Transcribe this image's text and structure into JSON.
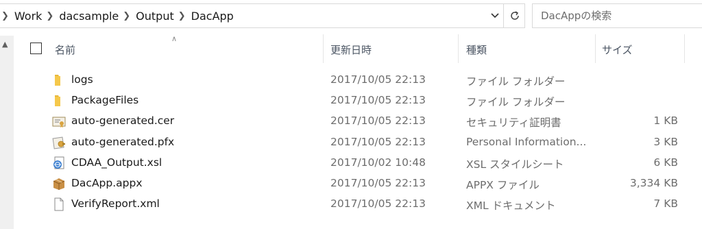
{
  "breadcrumb": [
    "Work",
    "dacsample",
    "Output",
    "DacApp"
  ],
  "search": {
    "placeholder": "DacAppの検索"
  },
  "columns": {
    "name": "名前",
    "date": "更新日時",
    "type": "種類",
    "size": "サイズ"
  },
  "files": [
    {
      "icon": "folder-icon",
      "name": "logs",
      "date": "2017/10/05 22:13",
      "type": "ファイル フォルダー",
      "size": ""
    },
    {
      "icon": "folder-icon",
      "name": "PackageFiles",
      "date": "2017/10/05 22:13",
      "type": "ファイル フォルダー",
      "size": ""
    },
    {
      "icon": "certificate-icon",
      "name": "auto-generated.cer",
      "date": "2017/10/05 22:13",
      "type": "セキュリティ証明書",
      "size": "1 KB"
    },
    {
      "icon": "pfx-icon",
      "name": "auto-generated.pfx",
      "date": "2017/10/05 22:13",
      "type": "Personal Information...",
      "size": "3 KB"
    },
    {
      "icon": "xsl-icon",
      "name": "CDAA_Output.xsl",
      "date": "2017/10/02 10:48",
      "type": "XSL スタイルシート",
      "size": "6 KB"
    },
    {
      "icon": "package-icon",
      "name": "DacApp.appx",
      "date": "2017/10/05 22:13",
      "type": "APPX ファイル",
      "size": "3,334 KB"
    },
    {
      "icon": "document-icon",
      "name": "VerifyReport.xml",
      "date": "2017/10/05 22:13",
      "type": "XML ドキュメント",
      "size": "7 KB"
    }
  ]
}
